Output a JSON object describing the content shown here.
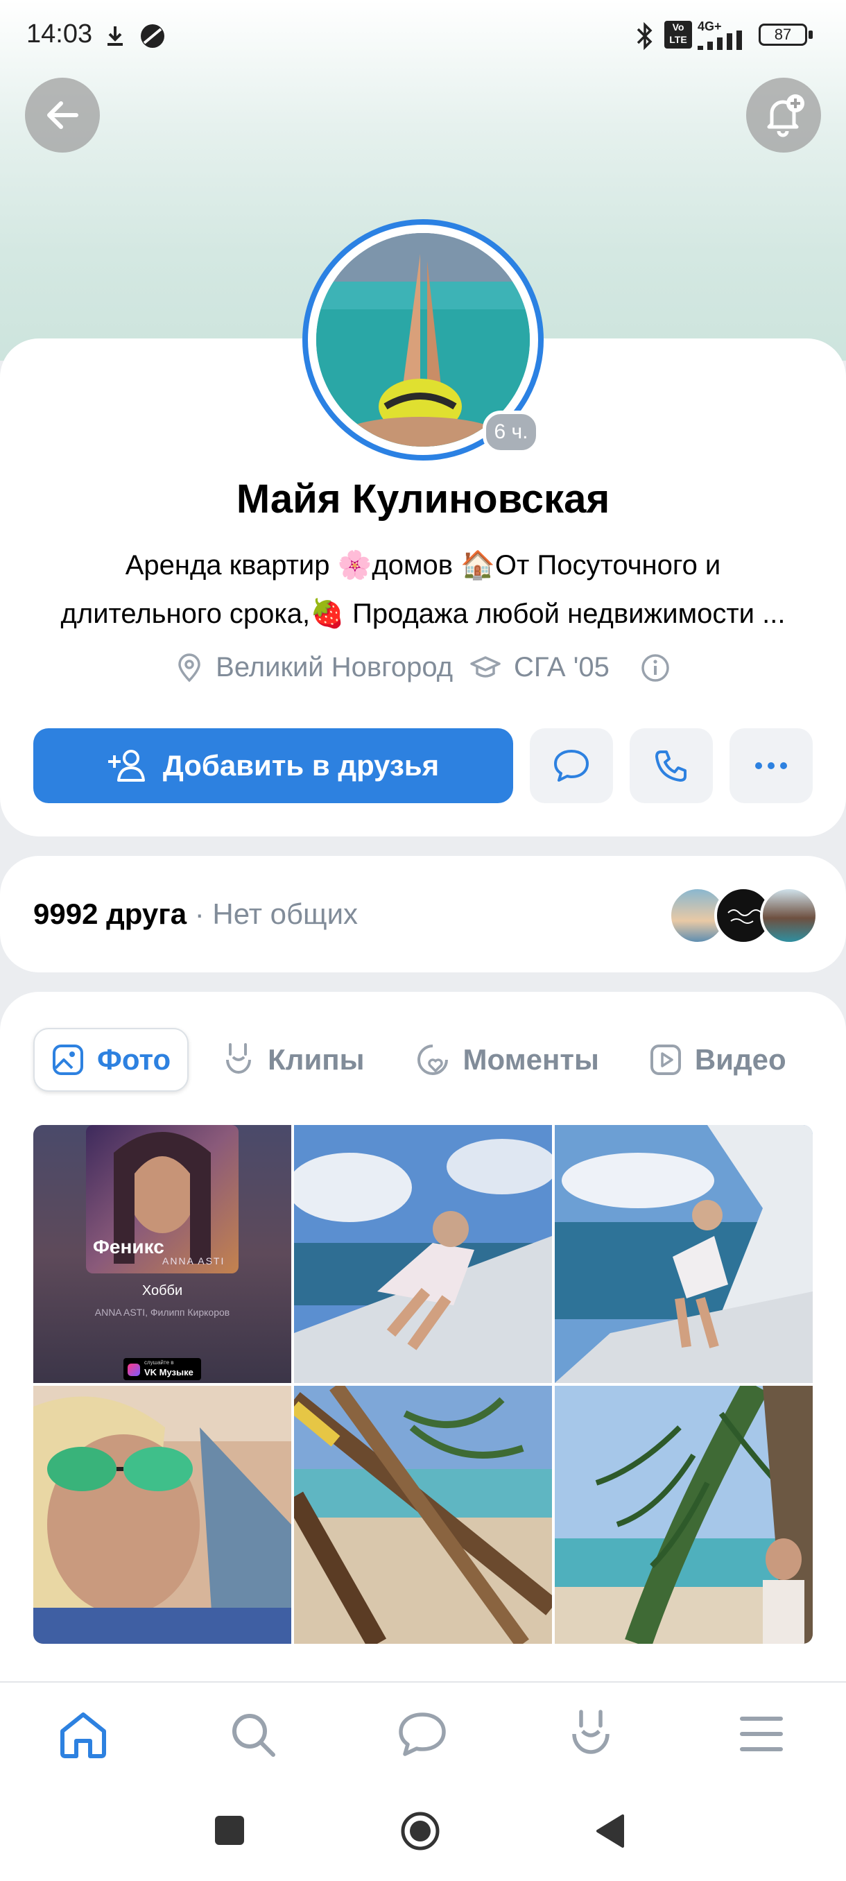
{
  "status_bar": {
    "time": "14:03",
    "network": "4G+",
    "volte": "Vo LTE",
    "battery": "87"
  },
  "profile": {
    "name": "Майя Кулиновская",
    "status_line1": "Аренда квартир 🌸домов 🏠От Посуточного и",
    "status_line2": "длительного срока,🍓 Продажа любой недвижимости ...",
    "city": "Великий Новгород",
    "education": "СГА '05",
    "story_age": "6 ч."
  },
  "actions": {
    "add_friend": "Добавить в друзья"
  },
  "friends": {
    "count": "9992 друга",
    "common": "· Нет общих"
  },
  "tabs": [
    {
      "label": "Фото",
      "icon": "photo-icon"
    },
    {
      "label": "Клипы",
      "icon": "clips-icon"
    },
    {
      "label": "Моменты",
      "icon": "moments-icon"
    },
    {
      "label": "Видео",
      "icon": "video-icon"
    }
  ],
  "music_card": {
    "album_text": "Феникс",
    "album_artist": "ANNA ASTI",
    "track": "Хобби",
    "artists": "ANNA ASTI, Филипп Киркоров",
    "badge": "VK Музыке",
    "badge_prefix": "слушайте в"
  },
  "colors": {
    "accent": "#2d81e0",
    "secondary_text": "#818c99"
  }
}
